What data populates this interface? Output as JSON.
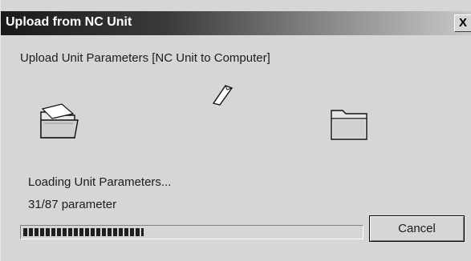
{
  "window": {
    "title": "Upload from NC Unit",
    "close_label": "X"
  },
  "dialog": {
    "heading": "Upload Unit Parameters [NC Unit to Computer]",
    "status_text": "Loading Unit Parameters...",
    "count_text": "31/87 parameter",
    "progress": {
      "current": 31,
      "total": 87
    },
    "cancel_label": "Cancel"
  },
  "icons": {
    "source": "open-folder-icon",
    "transfer": "flying-document-icon",
    "destination": "closed-folder-icon"
  }
}
